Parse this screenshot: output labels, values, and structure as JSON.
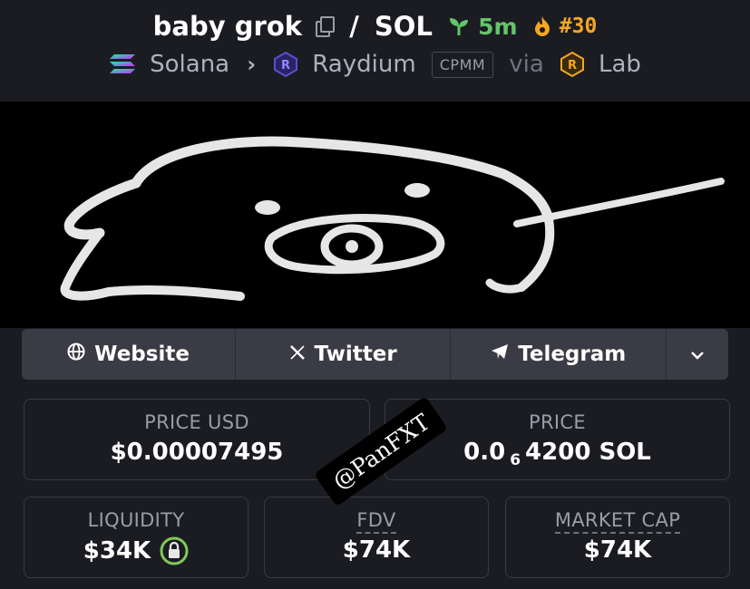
{
  "header": {
    "token_name": "baby grok",
    "separator": "/",
    "quote": "SOL",
    "age": "5m",
    "rank": "#30",
    "chain": "Solana",
    "dex": "Raydium",
    "pool_type": "CPMM",
    "via": "via",
    "launchpad": "Lab",
    "icons": [
      "copy-icon",
      "sprout-icon",
      "fire-icon",
      "solana-icon",
      "chevron-right-icon",
      "raydium-icon",
      "lab-icon"
    ]
  },
  "links": {
    "website": "Website",
    "twitter": "Twitter",
    "telegram": "Telegram",
    "icons": [
      "globe-icon",
      "x-icon",
      "telegram-icon",
      "chevron-down-icon"
    ]
  },
  "stats": {
    "price_usd_label": "PRICE USD",
    "price_usd_value": "$0.00007495",
    "price_label": "PRICE",
    "price_prefix": "0.0",
    "price_zeros": "6",
    "price_suffix": "4200 SOL",
    "liquidity_label": "LIQUIDITY",
    "liquidity_value": "$34K",
    "fdv_label": "FDV",
    "fdv_value": "$74K",
    "mcap_label": "MARKET CAP",
    "mcap_value": "$74K"
  },
  "watermark": "@PanFXT",
  "colors": {
    "background": "#1b1c22",
    "link_bar": "#3a3b44",
    "age_green": "#63c46b",
    "rank_orange": "#f5a623",
    "lock_green": "#7fc95a",
    "raydium_purple": "#5a4fcf"
  }
}
